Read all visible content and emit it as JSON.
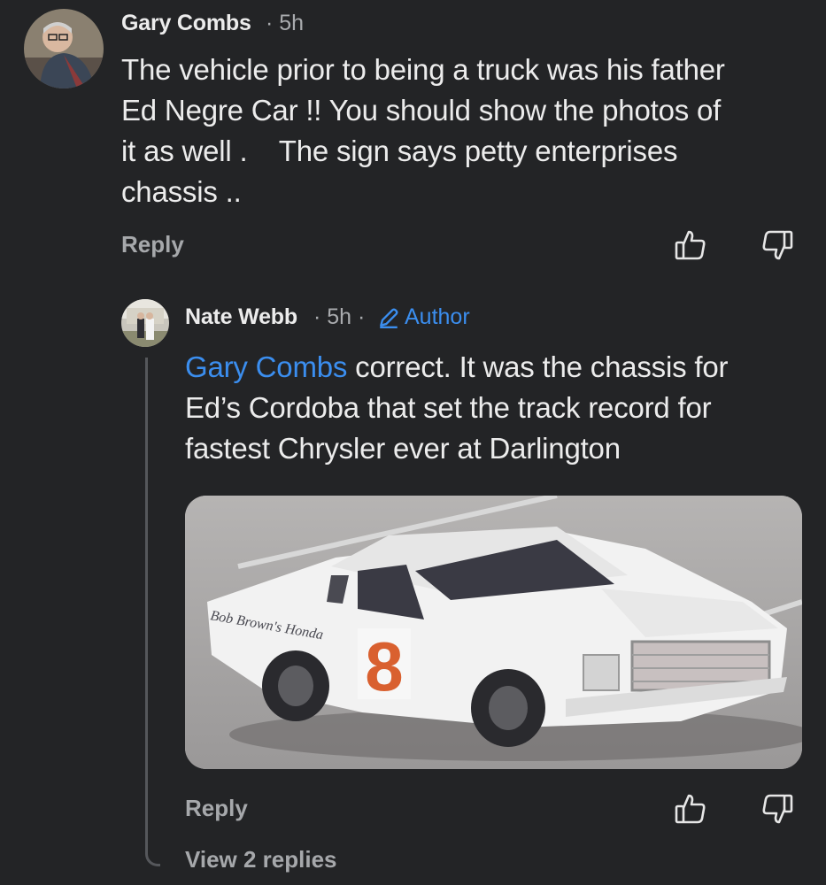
{
  "comment": {
    "author": "Gary Combs",
    "time": "· 5h",
    "lines": [
      "The vehicle prior to being a truck was his father",
      "Ed Negre Car !! You should show the photos of",
      "it as well .    The sign says petty enterprises",
      "chassis .."
    ],
    "reply_label": "Reply",
    "like_icon": "thumbs-up-icon",
    "dislike_icon": "thumbs-down-icon"
  },
  "reply": {
    "author": "Nate Webb",
    "time": "· 5h ·",
    "badge": "Author",
    "mention": "Gary Combs",
    "line1_rest": " correct. It was the chassis for",
    "lines": [
      "Ed’s Cordoba that set the track record for",
      "fastest Chrysler ever at Darlington"
    ],
    "photo_car_number": "8",
    "photo_sponsor_text": "Bob Brown's Honda",
    "reply_label": "Reply",
    "view_replies": "View 2 replies"
  },
  "colors": {
    "background": "#232426",
    "accent": "#3b8eef",
    "muted": "#a6a8ab"
  }
}
